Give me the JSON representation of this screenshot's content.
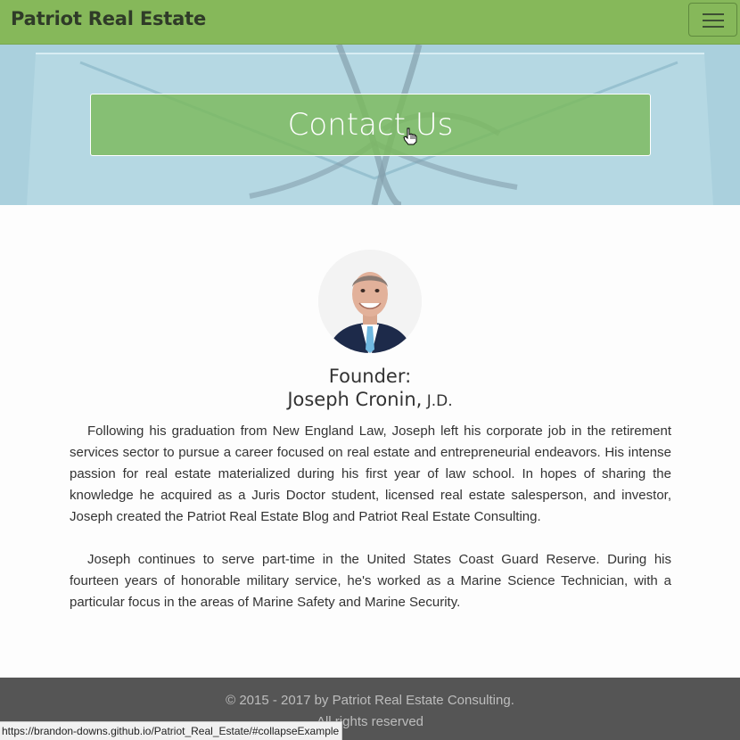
{
  "navbar": {
    "brand": "Patriot Real Estate",
    "menu_icon": "hamburger-menu-icon"
  },
  "hero": {
    "button_label": "Contact Us",
    "cursor_icon": "hand-pointer-icon"
  },
  "founder": {
    "label": "Founder:",
    "name": "Joseph Cronin,",
    "suffix": " J.D.",
    "paragraphs": [
      "Following his graduation from New England Law, Joseph left his corporate job in the retirement services sector to pursue a career focused on real estate and entrepreneurial endeavors. His intense passion for real estate materialized during his first year of law school. In hopes of sharing the knowledge he acquired as a Juris Doctor student, licensed real estate salesperson, and investor, Joseph created the Patriot Real Estate Blog and Patriot Real Estate Consulting.",
      "Joseph continues to serve part-time in the United States Coast Guard Reserve. During his fourteen years of honorable military service, he's worked as a Marine Science Technician, with a particular focus in the areas of Marine Safety and Marine Security."
    ]
  },
  "footer": {
    "copyright": "© 2015 - 2017 by Patriot Real Estate Consulting.",
    "rights": "All rights reserved"
  },
  "status_bar": {
    "url": "https://brandon-downs.github.io/Patriot_Real_Estate/#collapseExample"
  },
  "colors": {
    "navbar": "#86b85a",
    "button": "#7bba5c",
    "footer": "#555555"
  }
}
